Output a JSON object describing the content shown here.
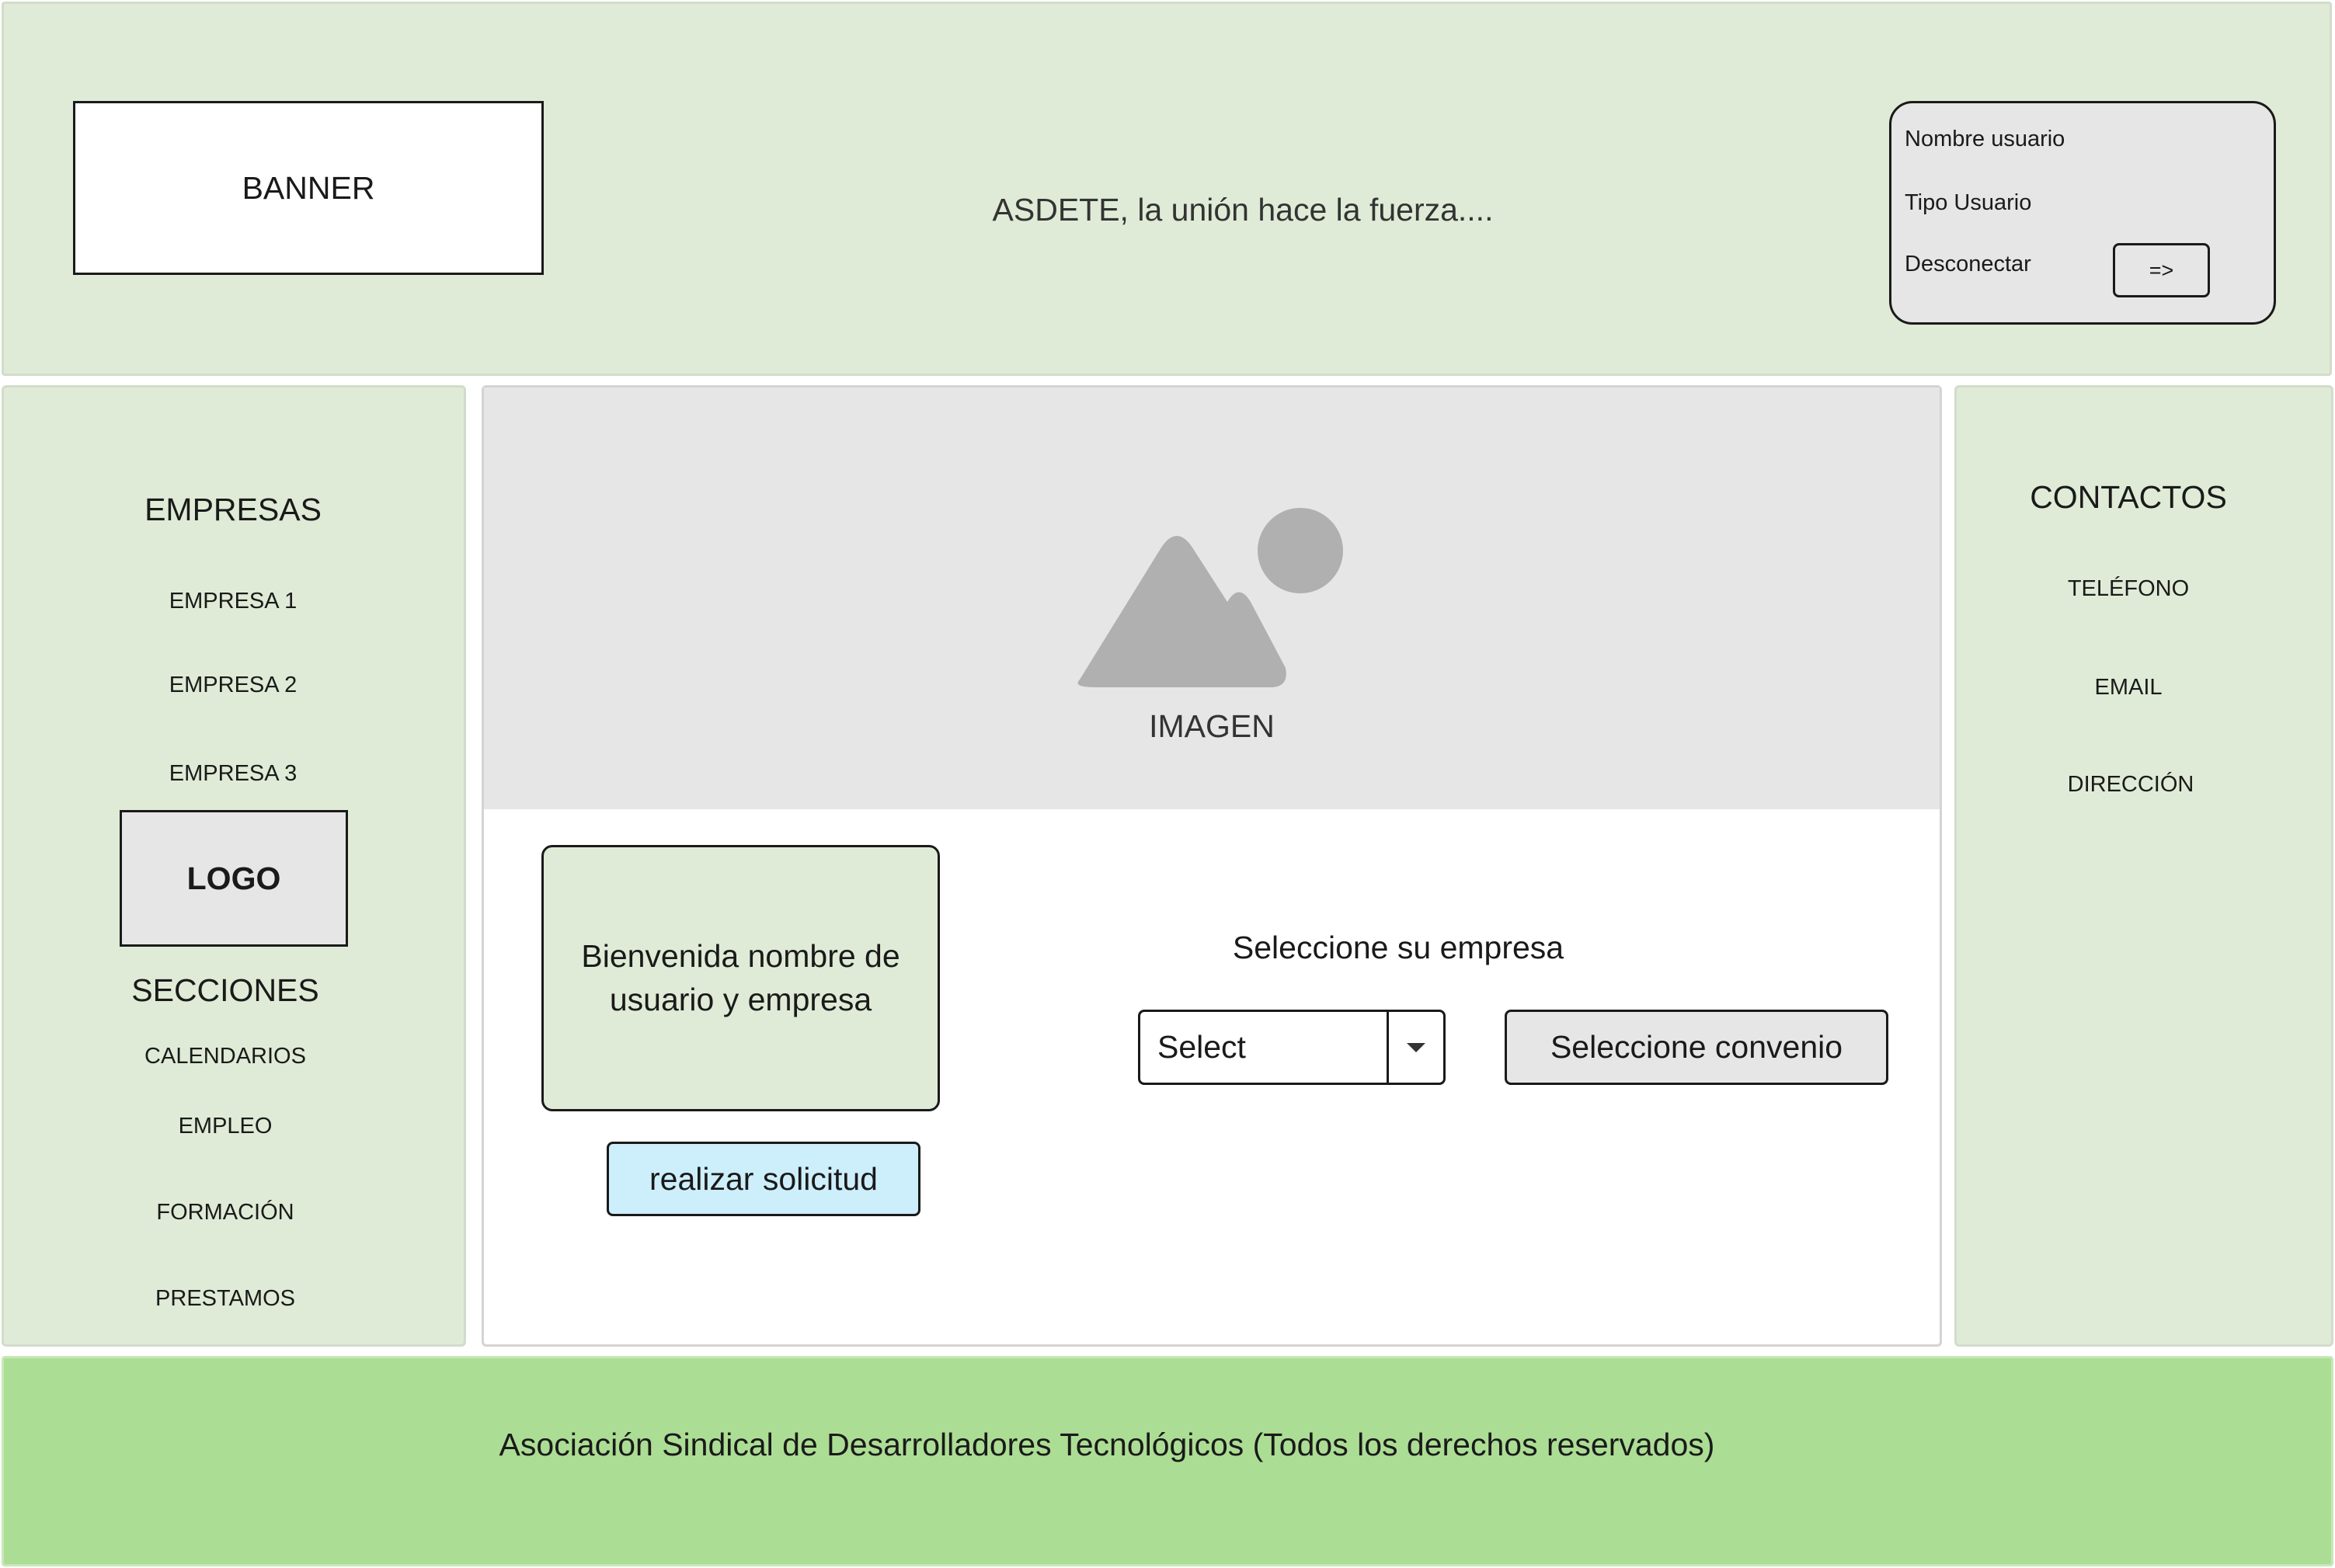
{
  "header": {
    "banner_label": "BANNER",
    "tagline": "ASDETE, la unión hace la fuerza....",
    "user": {
      "name_label": "Nombre usuario",
      "type_label": "Tipo Usuario",
      "logout_label": "Desconectar",
      "logout_button": "=>"
    }
  },
  "left_sidebar": {
    "companies_heading": "EMPRESAS",
    "companies": [
      "EMPRESA 1",
      "EMPRESA 2",
      "EMPRESA 3"
    ],
    "logo_label": "LOGO",
    "sections_heading": "SECCIONES",
    "sections": [
      "CALENDARIOS",
      "EMPLEO",
      "FORMACIÓN",
      "PRESTAMOS"
    ]
  },
  "main": {
    "image_label": "IMAGEN",
    "welcome_text": "Bienvenida nombre de usuario y empresa",
    "request_button": "realizar solicitud",
    "select_label": "Seleccione su empresa",
    "select_value": "Select",
    "convenio_button": "Seleccione convenio"
  },
  "right_sidebar": {
    "heading": "CONTACTOS",
    "items": [
      "TELÉFONO",
      "EMAIL",
      "DIRECCIÓN"
    ]
  },
  "footer": {
    "text": "Asociación Sindical de Desarrolladores Tecnológicos (Todos los derechos reservados)"
  },
  "colors": {
    "light_green": "#dfebd6",
    "footer_green": "#acdd94",
    "gray_panel": "#e6e6e6",
    "light_blue_button": "#cdeffc",
    "image_placeholder": "#b0b0b0"
  },
  "icons": {
    "image_placeholder": "image-placeholder-icon",
    "dropdown": "caret-down-icon"
  }
}
